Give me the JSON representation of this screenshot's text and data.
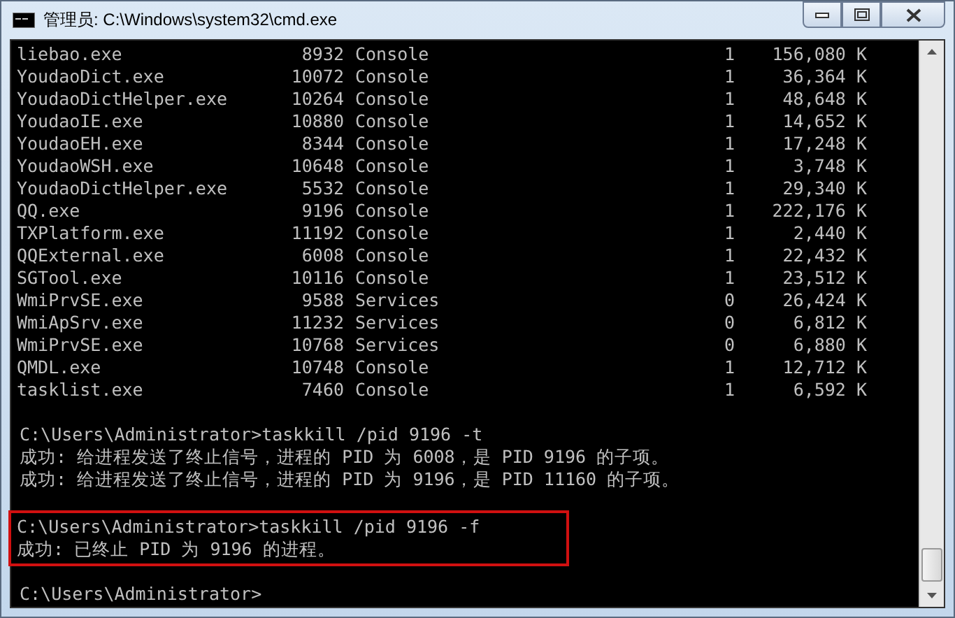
{
  "window": {
    "title": "管理员: C:\\Windows\\system32\\cmd.exe"
  },
  "process_table": [
    {
      "name": "liebao.exe",
      "pid": "8932",
      "session_name": "Console",
      "session": "1",
      "memory": "156,080 K"
    },
    {
      "name": "YoudaoDict.exe",
      "pid": "10072",
      "session_name": "Console",
      "session": "1",
      "memory": "36,364 K"
    },
    {
      "name": "YoudaoDictHelper.exe",
      "pid": "10264",
      "session_name": "Console",
      "session": "1",
      "memory": "48,648 K"
    },
    {
      "name": "YoudaoIE.exe",
      "pid": "10880",
      "session_name": "Console",
      "session": "1",
      "memory": "14,652 K"
    },
    {
      "name": "YoudaoEH.exe",
      "pid": "8344",
      "session_name": "Console",
      "session": "1",
      "memory": "17,248 K"
    },
    {
      "name": "YoudaoWSH.exe",
      "pid": "10648",
      "session_name": "Console",
      "session": "1",
      "memory": "3,748 K"
    },
    {
      "name": "YoudaoDictHelper.exe",
      "pid": "5532",
      "session_name": "Console",
      "session": "1",
      "memory": "29,340 K"
    },
    {
      "name": "QQ.exe",
      "pid": "9196",
      "session_name": "Console",
      "session": "1",
      "memory": "222,176 K"
    },
    {
      "name": "TXPlatform.exe",
      "pid": "11192",
      "session_name": "Console",
      "session": "1",
      "memory": "2,440 K"
    },
    {
      "name": "QQExternal.exe",
      "pid": "6008",
      "session_name": "Console",
      "session": "1",
      "memory": "22,432 K"
    },
    {
      "name": "SGTool.exe",
      "pid": "10116",
      "session_name": "Console",
      "session": "1",
      "memory": "23,512 K"
    },
    {
      "name": "WmiPrvSE.exe",
      "pid": "9588",
      "session_name": "Services",
      "session": "0",
      "memory": "26,424 K"
    },
    {
      "name": "WmiApSrv.exe",
      "pid": "11232",
      "session_name": "Services",
      "session": "0",
      "memory": "6,812 K"
    },
    {
      "name": "WmiPrvSE.exe",
      "pid": "10768",
      "session_name": "Services",
      "session": "0",
      "memory": "6,880 K"
    },
    {
      "name": "QMDL.exe",
      "pid": "10748",
      "session_name": "Console",
      "session": "1",
      "memory": "12,712 K"
    },
    {
      "name": "tasklist.exe",
      "pid": "7460",
      "session_name": "Console",
      "session": "1",
      "memory": "6,592 K"
    }
  ],
  "console_blocks": [
    {
      "highlighted": false,
      "lines": [
        "C:\\Users\\Administrator>taskkill /pid 9196 -t",
        "成功: 给进程发送了终止信号，进程的 PID 为 6008，是 PID 9196 的子项。",
        "成功: 给进程发送了终止信号，进程的 PID 为 9196，是 PID 11160 的子项。"
      ]
    },
    {
      "highlighted": true,
      "lines": [
        "C:\\Users\\Administrator>taskkill /pid 9196 -f",
        "成功: 已终止 PID 为 9196 的进程。"
      ]
    },
    {
      "highlighted": false,
      "lines": [
        "C:\\Users\\Administrator>"
      ]
    }
  ]
}
